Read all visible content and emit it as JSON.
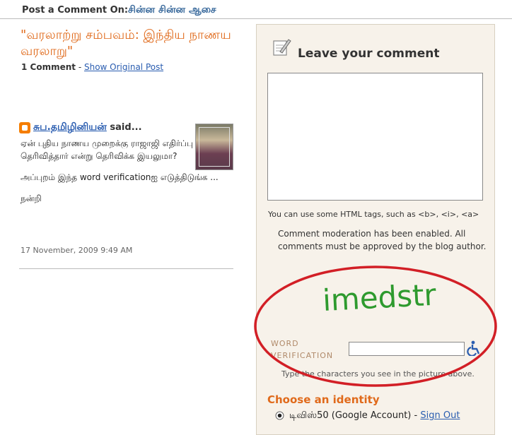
{
  "header": {
    "prefix": "Post a Comment On:",
    "blog_name": "சின்ன சின்ன ஆசை"
  },
  "post": {
    "title": "\"வரலாற்று சம்பவம்: இந்திய நாணய வரலாறு\"",
    "comment_count": "1 Comment",
    "separator": " - ",
    "show_original": "Show Original Post"
  },
  "comment": {
    "author": "சுப.தமிழினியன்",
    "said": " said...",
    "paragraphs": [
      "ஏன் புதிய நாணய முறைக்கு ராஜாஜி எதிர்ப்பு தெரிவித்தார் என்று தெரிவிக்க இயலுமா?",
      "அப்புறம் இந்த word verificationஐ எடுத்திடுங்க ...",
      "நன்றி"
    ],
    "timestamp": "17 November, 2009 9:49 AM"
  },
  "form": {
    "heading": "Leave your comment",
    "html_hint": "You can use some HTML tags, such as <b>, <i>, <a>",
    "moderation": "Comment moderation has been enabled. All comments must be approved by the blog author.",
    "captcha_text": "imedstr",
    "word_verification_line1": "WORD",
    "word_verification_line2": "VERIFICATION",
    "type_hint": "Type the characters you see in the picture above.",
    "choose_identity": "Choose an identity",
    "account_name": "டிவிஸ்50 (Google Account)",
    "account_sep": " - ",
    "sign_out": "Sign Out"
  },
  "colors": {
    "accent_orange": "#e06a1b",
    "link_blue": "#2a5db0",
    "panel_bg": "#f7f2ea",
    "annotation_red": "#d21f26",
    "captcha_green": "#2e9a2e"
  },
  "icons": [
    "blogger-icon",
    "pencil-icon",
    "accessibility-icon",
    "radio-selected-icon"
  ]
}
